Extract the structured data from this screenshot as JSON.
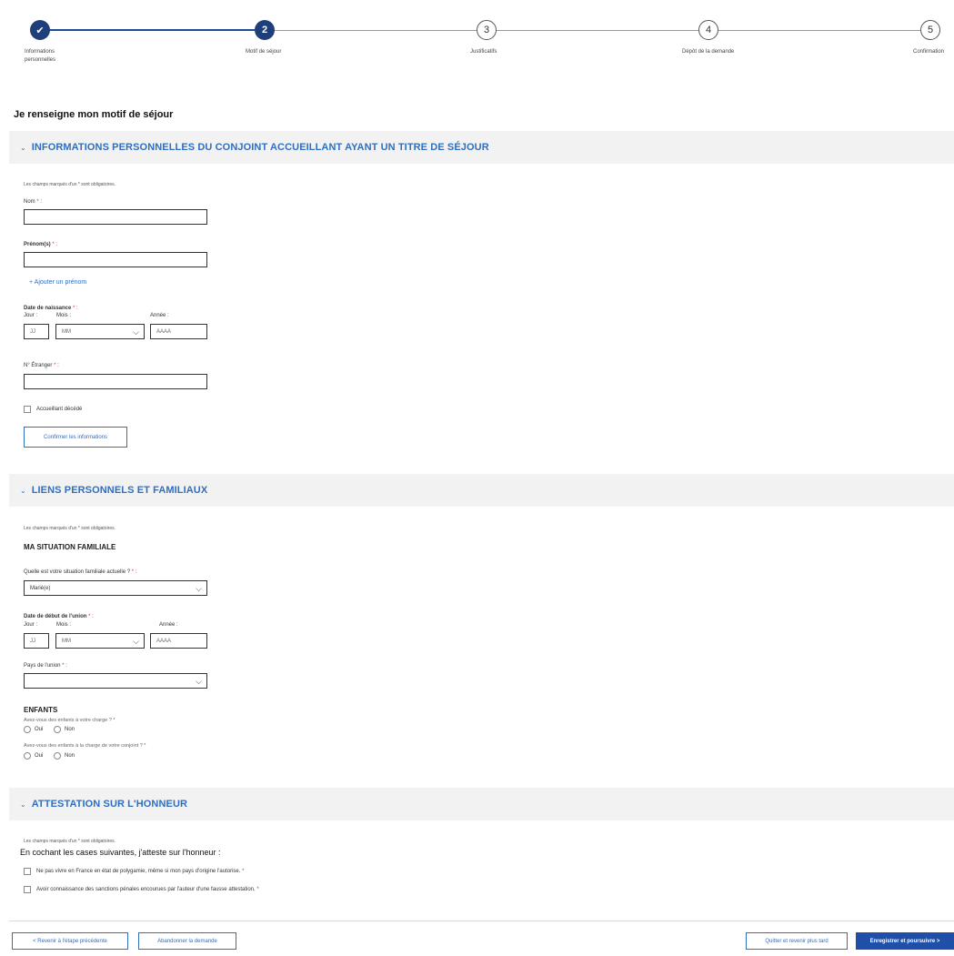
{
  "stepper": {
    "steps": [
      {
        "number": "✔",
        "label_line1": "Informations",
        "label_line2": "personnelles",
        "state": "done"
      },
      {
        "number": "2",
        "label_line1": "Motif de séjour",
        "label_line2": "",
        "state": "active"
      },
      {
        "number": "3",
        "label_line1": "Justificatifs",
        "label_line2": "",
        "state": "todo"
      },
      {
        "number": "4",
        "label_line1": "Dépôt de la demande",
        "label_line2": "",
        "state": "todo"
      },
      {
        "number": "5",
        "label_line1": "Confirmation",
        "label_line2": "",
        "state": "todo"
      }
    ]
  },
  "page_heading": "Je renseigne mon motif de séjour",
  "section1": {
    "title": "INFORMATIONS PERSONNELLES DU CONJOINT ACCUEILLANT AYANT UN TITRE DE SÉJOUR",
    "required_note": "Les champs marqués d'un * sont obligatoires.",
    "nom_label": "Nom",
    "prenom_label": "Prénom(s)",
    "add_prenom": "+ Ajouter un prénom",
    "dob_label": "Date de naissance",
    "day_label": "Jour :",
    "month_label": "Mois :",
    "year_label": "Année :",
    "day_placeholder": "JJ",
    "month_placeholder": "MM",
    "year_placeholder": "AAAA",
    "etranger_label": "N° Étranger",
    "deceased_label": "Accueillant décédé",
    "confirm_button": "Confirmer les informations"
  },
  "section2": {
    "title": "LIENS PERSONNELS ET FAMILIAUX",
    "required_note": "Les champs marqués d'un * sont obligatoires.",
    "situation_heading": "MA SITUATION FAMILIALE",
    "situation_question": "Quelle est votre situation familiale actuelle ?",
    "situation_value": "Marié(e)",
    "union_date_label": "Date de début de l'union",
    "day_label": "Jour :",
    "month_label": "Mois :",
    "year_label": "Année :",
    "day_placeholder": "JJ",
    "month_placeholder": "MM",
    "year_placeholder": "AAAA",
    "union_country_label": "Pays de l'union",
    "union_country_value": "",
    "children_heading": "ENFANTS",
    "children_q1": "Avez-vous des enfants à votre charge ?",
    "children_q2": "Avez-vous des enfants à la charge de votre conjoint ?",
    "yes": "Oui",
    "no": "Non"
  },
  "section3": {
    "title": "ATTESTATION SUR L'HONNEUR",
    "required_note": "Les champs marqués d'un * sont obligatoires.",
    "intro": "En cochant les cases suivantes, j'atteste sur l'honneur :",
    "check1": "Ne pas vivre en France en état de polygamie, même si mon pays d'origine l'autorise.",
    "check2": "Avoir connaissance des sanctions pénales encourues par l'auteur d'une fausse attestation."
  },
  "footer": {
    "back_button": "< Revenir à l'étape précédente",
    "abandon_button": "Abandonner la demande",
    "quit_button": "Quitter et revenir plus tard",
    "save_button": "Enregistrer et poursuivre >"
  },
  "required_mark": "*",
  "colors": {
    "primary": "#1f3f7a",
    "link": "#2f6fc0",
    "required": "#d9302c"
  }
}
